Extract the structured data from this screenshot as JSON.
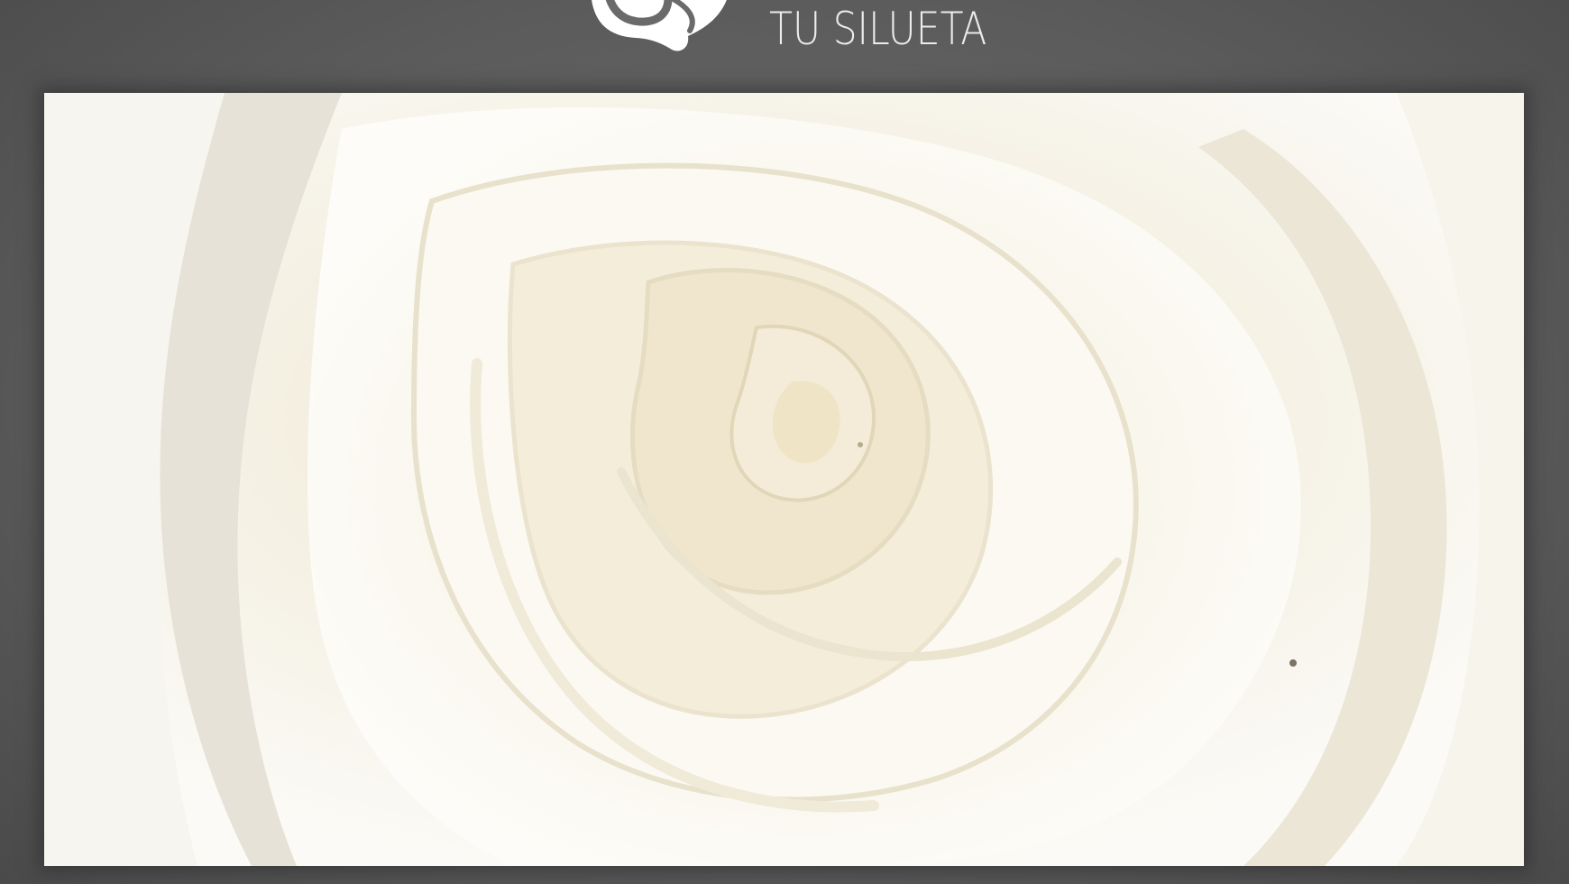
{
  "brand": {
    "tagline": "TU SILUETA",
    "logo_icon": "rose-logo-icon"
  },
  "photo": {
    "subject": "white-rose-icon"
  },
  "colors": {
    "background": "#5b5b5b",
    "brand_text": "#ececec",
    "rose_white": "#fbfaf5",
    "rose_cream": "#efe8d3"
  }
}
